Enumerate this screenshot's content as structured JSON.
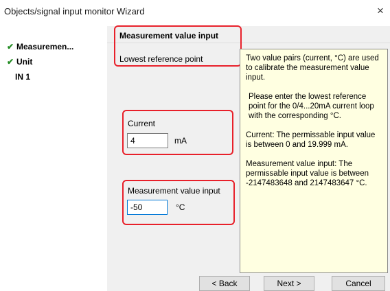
{
  "window": {
    "title": "Objects/signal input monitor Wizard",
    "close_symbol": "×"
  },
  "sidebar": {
    "items": [
      {
        "label": "Measuremen...",
        "checked": true,
        "icon": "check-icon"
      },
      {
        "label": "Unit",
        "checked": true,
        "icon": "check-icon"
      },
      {
        "label": "IN 1",
        "checked": false
      }
    ],
    "check_color": "#228b22"
  },
  "header": {
    "title": "Measurement value input",
    "subtitle": "Lowest reference point"
  },
  "form": {
    "current": {
      "label": "Current",
      "value": "4",
      "unit": "mA"
    },
    "measurement": {
      "label": "Measurement value input",
      "value": "-50",
      "unit": "°C"
    }
  },
  "help": {
    "paragraphs": [
      "Two value pairs (current, °C) are used to calibrate the measurement value input.",
      "Please enter the lowest reference point for the 0/4...20mA current loop with the corresponding °C.",
      "Current: The permissable input value is between 0 and 19.999 mA.",
      "Measurement value input: The permissable input value is between -2147483648 and 2147483647 °C."
    ]
  },
  "buttons": {
    "back": "< Back",
    "next": "Next >",
    "cancel": "Cancel"
  },
  "colors": {
    "highlight": "#e8202a",
    "help_background": "#ffffe1",
    "focus_border": "#0078d7"
  }
}
